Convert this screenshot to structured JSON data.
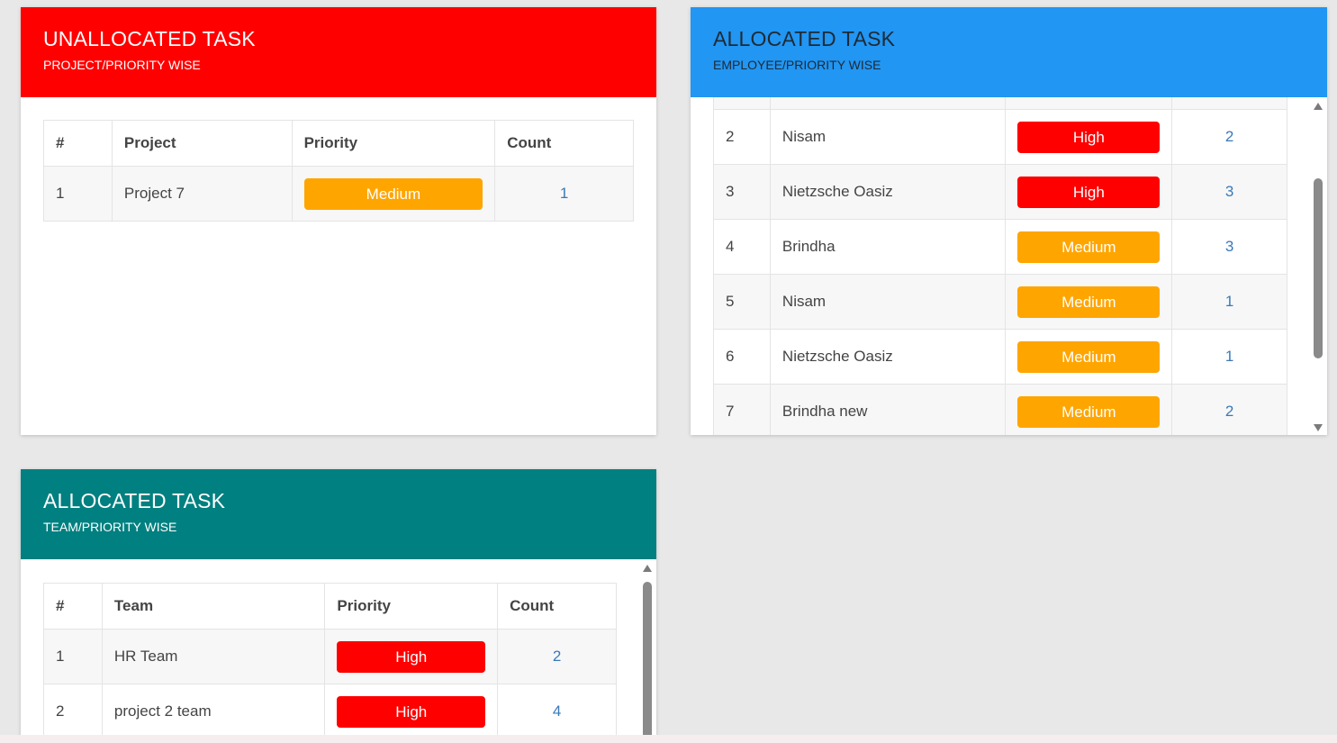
{
  "unallocated": {
    "title": "UNALLOCATED TASK",
    "subtitle": "PROJECT/PRIORITY WISE",
    "header_color": "#ff0000",
    "columns": [
      "#",
      "Project",
      "Priority",
      "Count"
    ],
    "rows": [
      {
        "num": "1",
        "name": "Project 7",
        "priority": "Medium",
        "count": "1"
      }
    ]
  },
  "employee": {
    "title": "ALLOCATED TASK",
    "subtitle": "EMPLOYEE/PRIORITY WISE",
    "header_color": "#2196f3",
    "rows": [
      {
        "num": "2",
        "name": "Nisam",
        "priority": "High",
        "count": "2"
      },
      {
        "num": "3",
        "name": "Nietzsche Oasiz",
        "priority": "High",
        "count": "3"
      },
      {
        "num": "4",
        "name": "Brindha",
        "priority": "Medium",
        "count": "3"
      },
      {
        "num": "5",
        "name": "Nisam",
        "priority": "Medium",
        "count": "1"
      },
      {
        "num": "6",
        "name": "Nietzsche Oasiz",
        "priority": "Medium",
        "count": "1"
      },
      {
        "num": "7",
        "name": "Brindha new",
        "priority": "Medium",
        "count": "2"
      }
    ]
  },
  "team": {
    "title": "ALLOCATED TASK",
    "subtitle": "TEAM/PRIORITY WISE",
    "header_color": "#008080",
    "columns": [
      "#",
      "Team",
      "Priority",
      "Count"
    ],
    "rows": [
      {
        "num": "1",
        "name": "HR Team",
        "priority": "High",
        "count": "2"
      },
      {
        "num": "2",
        "name": "project 2 team",
        "priority": "High",
        "count": "4"
      }
    ]
  },
  "colors": {
    "high": "#ff0000",
    "medium": "#ffa500",
    "count_link": "#3a79b8"
  }
}
